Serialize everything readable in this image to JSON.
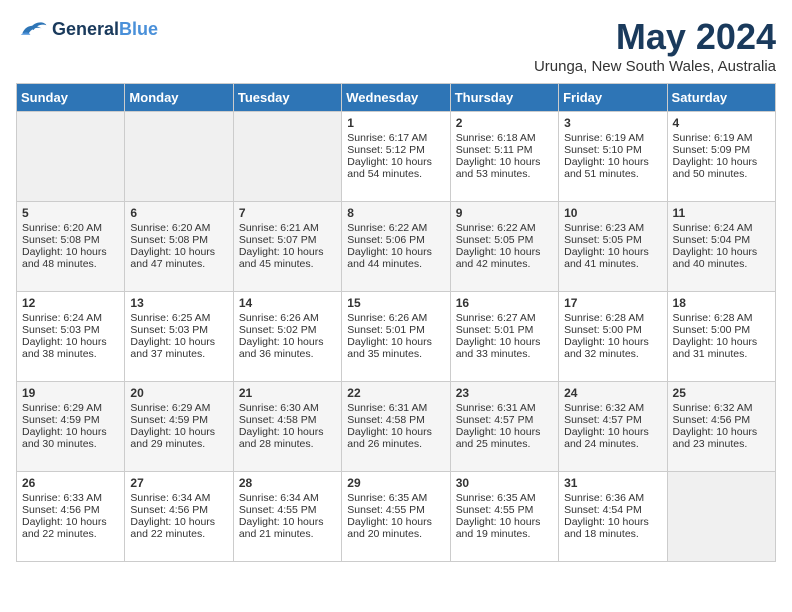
{
  "logo": {
    "line1": "General",
    "line2": "Blue"
  },
  "title": "May 2024",
  "subtitle": "Urunga, New South Wales, Australia",
  "headers": [
    "Sunday",
    "Monday",
    "Tuesday",
    "Wednesday",
    "Thursday",
    "Friday",
    "Saturday"
  ],
  "weeks": [
    [
      {
        "day": "",
        "empty": true
      },
      {
        "day": "",
        "empty": true
      },
      {
        "day": "",
        "empty": true
      },
      {
        "day": "1",
        "sunrise": "6:17 AM",
        "sunset": "5:12 PM",
        "daylight": "10 hours and 54 minutes."
      },
      {
        "day": "2",
        "sunrise": "6:18 AM",
        "sunset": "5:11 PM",
        "daylight": "10 hours and 53 minutes."
      },
      {
        "day": "3",
        "sunrise": "6:19 AM",
        "sunset": "5:10 PM",
        "daylight": "10 hours and 51 minutes."
      },
      {
        "day": "4",
        "sunrise": "6:19 AM",
        "sunset": "5:09 PM",
        "daylight": "10 hours and 50 minutes."
      }
    ],
    [
      {
        "day": "5",
        "sunrise": "6:20 AM",
        "sunset": "5:08 PM",
        "daylight": "10 hours and 48 minutes."
      },
      {
        "day": "6",
        "sunrise": "6:20 AM",
        "sunset": "5:08 PM",
        "daylight": "10 hours and 47 minutes."
      },
      {
        "day": "7",
        "sunrise": "6:21 AM",
        "sunset": "5:07 PM",
        "daylight": "10 hours and 45 minutes."
      },
      {
        "day": "8",
        "sunrise": "6:22 AM",
        "sunset": "5:06 PM",
        "daylight": "10 hours and 44 minutes."
      },
      {
        "day": "9",
        "sunrise": "6:22 AM",
        "sunset": "5:05 PM",
        "daylight": "10 hours and 42 minutes."
      },
      {
        "day": "10",
        "sunrise": "6:23 AM",
        "sunset": "5:05 PM",
        "daylight": "10 hours and 41 minutes."
      },
      {
        "day": "11",
        "sunrise": "6:24 AM",
        "sunset": "5:04 PM",
        "daylight": "10 hours and 40 minutes."
      }
    ],
    [
      {
        "day": "12",
        "sunrise": "6:24 AM",
        "sunset": "5:03 PM",
        "daylight": "10 hours and 38 minutes."
      },
      {
        "day": "13",
        "sunrise": "6:25 AM",
        "sunset": "5:03 PM",
        "daylight": "10 hours and 37 minutes."
      },
      {
        "day": "14",
        "sunrise": "6:26 AM",
        "sunset": "5:02 PM",
        "daylight": "10 hours and 36 minutes."
      },
      {
        "day": "15",
        "sunrise": "6:26 AM",
        "sunset": "5:01 PM",
        "daylight": "10 hours and 35 minutes."
      },
      {
        "day": "16",
        "sunrise": "6:27 AM",
        "sunset": "5:01 PM",
        "daylight": "10 hours and 33 minutes."
      },
      {
        "day": "17",
        "sunrise": "6:28 AM",
        "sunset": "5:00 PM",
        "daylight": "10 hours and 32 minutes."
      },
      {
        "day": "18",
        "sunrise": "6:28 AM",
        "sunset": "5:00 PM",
        "daylight": "10 hours and 31 minutes."
      }
    ],
    [
      {
        "day": "19",
        "sunrise": "6:29 AM",
        "sunset": "4:59 PM",
        "daylight": "10 hours and 30 minutes."
      },
      {
        "day": "20",
        "sunrise": "6:29 AM",
        "sunset": "4:59 PM",
        "daylight": "10 hours and 29 minutes."
      },
      {
        "day": "21",
        "sunrise": "6:30 AM",
        "sunset": "4:58 PM",
        "daylight": "10 hours and 28 minutes."
      },
      {
        "day": "22",
        "sunrise": "6:31 AM",
        "sunset": "4:58 PM",
        "daylight": "10 hours and 26 minutes."
      },
      {
        "day": "23",
        "sunrise": "6:31 AM",
        "sunset": "4:57 PM",
        "daylight": "10 hours and 25 minutes."
      },
      {
        "day": "24",
        "sunrise": "6:32 AM",
        "sunset": "4:57 PM",
        "daylight": "10 hours and 24 minutes."
      },
      {
        "day": "25",
        "sunrise": "6:32 AM",
        "sunset": "4:56 PM",
        "daylight": "10 hours and 23 minutes."
      }
    ],
    [
      {
        "day": "26",
        "sunrise": "6:33 AM",
        "sunset": "4:56 PM",
        "daylight": "10 hours and 22 minutes."
      },
      {
        "day": "27",
        "sunrise": "6:34 AM",
        "sunset": "4:56 PM",
        "daylight": "10 hours and 22 minutes."
      },
      {
        "day": "28",
        "sunrise": "6:34 AM",
        "sunset": "4:55 PM",
        "daylight": "10 hours and 21 minutes."
      },
      {
        "day": "29",
        "sunrise": "6:35 AM",
        "sunset": "4:55 PM",
        "daylight": "10 hours and 20 minutes."
      },
      {
        "day": "30",
        "sunrise": "6:35 AM",
        "sunset": "4:55 PM",
        "daylight": "10 hours and 19 minutes."
      },
      {
        "day": "31",
        "sunrise": "6:36 AM",
        "sunset": "4:54 PM",
        "daylight": "10 hours and 18 minutes."
      },
      {
        "day": "",
        "empty": true
      }
    ]
  ]
}
